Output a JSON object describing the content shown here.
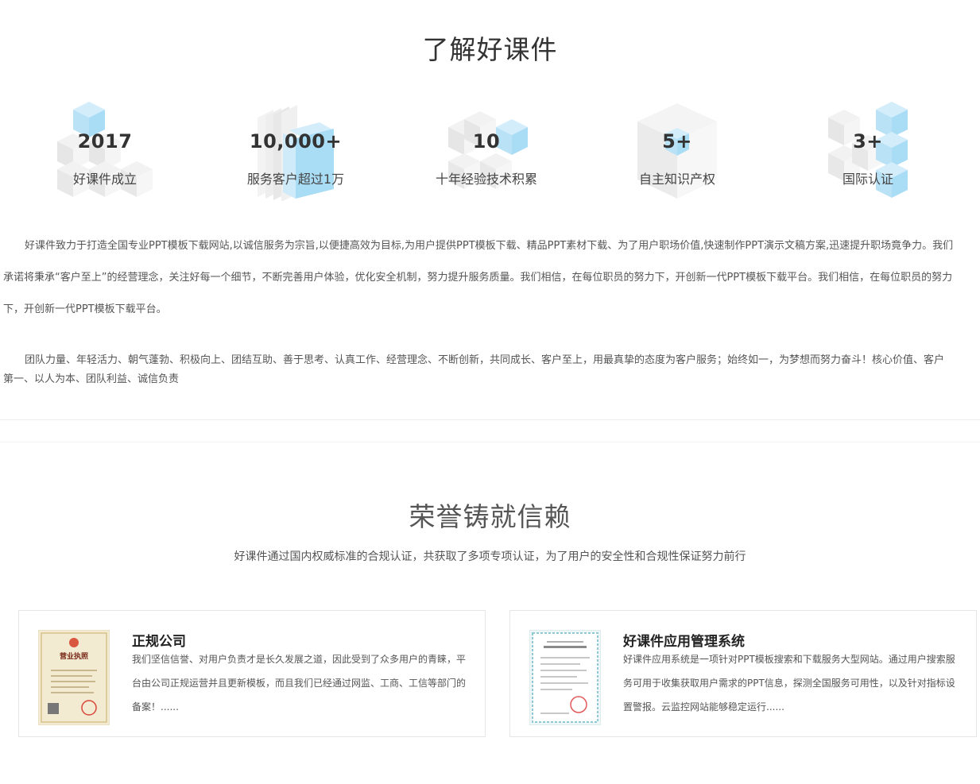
{
  "about": {
    "title": "了解好课件",
    "stats": [
      {
        "number": "2017",
        "label": "好课件成立"
      },
      {
        "number": "10,000+",
        "label": "服务客户超过1万"
      },
      {
        "number": "10",
        "label": "十年经验技术积累"
      },
      {
        "number": "5+",
        "label": "自主知识产权"
      },
      {
        "number": "3+",
        "label": "国际认证"
      }
    ],
    "paragraph1": "好课件致力于打造全国专业PPT模板下载网站,以诚信服务为宗旨,以便捷高效为目标,为用户提供PPT模板下载、精品PPT素材下载、为了用户职场价值,快速制作PPT演示文稿方案,迅速提升职场竟争力。我们承诺将秉承“客户至上”的经营理念，关注好每一个细节，不断完善用户体验，优化安全机制，努力提升服务质量。我们相信，在每位职员的努力下，开创新一代PPT模板下载平台。我们相信，在每位职员的努力下，开创新一代PPT模板下载平台。",
    "paragraph2": "团队力量、年轻活力、朝气蓬勃、积极向上、团结互助、善于思考、认真工作、经营理念、不断创新，共同成长、客户至上，用最真挚的态度为客户服务；始终如一，为梦想而努力奋斗！核心价值、客户第一、以人为本、团队利益、诚信负责"
  },
  "honor": {
    "title": "荣誉铸就信赖",
    "subtitle": "好课件通过国内权威标准的合规认证，共获取了多项专项认证，为了用户的安全性和合规性保证努力前行",
    "cards": [
      {
        "title": "正规公司",
        "desc": "我们坚信信誉、对用户负责才是长久发展之道，因此受到了众多用户的青睐，平台由公司正规运营并且更新模板，而且我们已经通过网监、工商、工信等部门的备案！......",
        "thumb_text": "营业执照"
      },
      {
        "title": "好课件应用管理系统",
        "desc": "好课件应用系统是一项针对PPT模板搜索和下载服务大型网站。通过用户搜索服务可用于收集获取用户需求的PPT信息，探测全国服务可用性，以及针对指标设置警报。云监控网站能够稳定运行......"
      }
    ]
  },
  "colors": {
    "cube_blue": "#a9dcf5",
    "cube_gray": "#ebebeb",
    "text_dark": "#333333"
  }
}
